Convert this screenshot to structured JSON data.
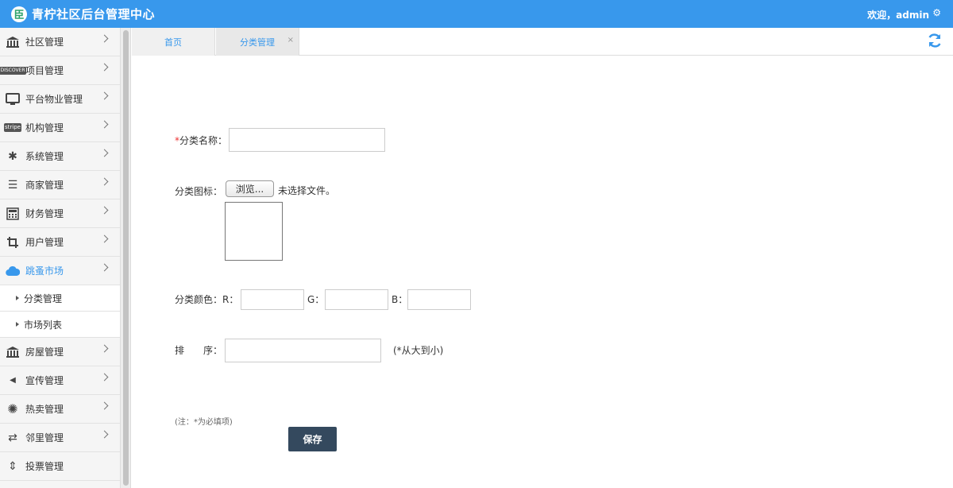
{
  "header": {
    "logo_glyph": "⾂",
    "title": "青柠社区后台管理中心",
    "welcome": "欢迎，admin",
    "settings_glyph": "⚙"
  },
  "sidebar": {
    "items": [
      {
        "label": "社区管理",
        "icon": "bank-icon",
        "glyph": "🏛"
      },
      {
        "label": "项目管理",
        "icon": "card-icon",
        "glyph": "DISCOVER"
      },
      {
        "label": "平台物业管理",
        "icon": "monitor-icon",
        "glyph": "🖥"
      },
      {
        "label": "机构管理",
        "icon": "stripe-icon",
        "glyph": "stripe"
      },
      {
        "label": "系统管理",
        "icon": "yelp-icon",
        "glyph": "✱"
      },
      {
        "label": "商家管理",
        "icon": "menu-icon",
        "glyph": "☰"
      },
      {
        "label": "财务管理",
        "icon": "calculator-icon",
        "glyph": "▦"
      },
      {
        "label": "用户管理",
        "icon": "crop-icon",
        "glyph": "⌗"
      },
      {
        "label": "跳蚤市场",
        "icon": "cloud-icon",
        "glyph": "☁",
        "active": true
      },
      {
        "label": "房屋管理",
        "icon": "bank-icon",
        "glyph": "🏛"
      },
      {
        "label": "宣传管理",
        "icon": "volume-icon",
        "glyph": "◀"
      },
      {
        "label": "热卖管理",
        "icon": "sun-icon",
        "glyph": "✺"
      },
      {
        "label": "邻里管理",
        "icon": "retweet-icon",
        "glyph": "⇄"
      },
      {
        "label": "投票管理",
        "icon": "sort-icon",
        "glyph": "⇕"
      }
    ],
    "sub_items": [
      {
        "label": "分类管理"
      },
      {
        "label": "市场列表"
      }
    ]
  },
  "tabs": {
    "home": "首页",
    "category": "分类管理",
    "close_glyph": "×",
    "refresh_glyph": "⟳"
  },
  "form": {
    "required_mark": "*",
    "name_label": "分类名称：",
    "name_value": "",
    "icon_label": "分类图标：",
    "browse_label": "浏览...",
    "no_file_text": "未选择文件。",
    "color_label": "分类颜色：R：",
    "g_label": "G：",
    "b_label": "B：",
    "r_value": "",
    "g_value": "",
    "b_value": "",
    "sort_label": "排　　序：",
    "sort_value": "",
    "sort_hint": "(*从大到小)",
    "note": "(注：*为必填项)",
    "save_label": "保存"
  },
  "colors": {
    "header_bg": "#3898ec",
    "accent": "#3898ec",
    "save_bg": "#34495e",
    "required": "#e33333"
  }
}
